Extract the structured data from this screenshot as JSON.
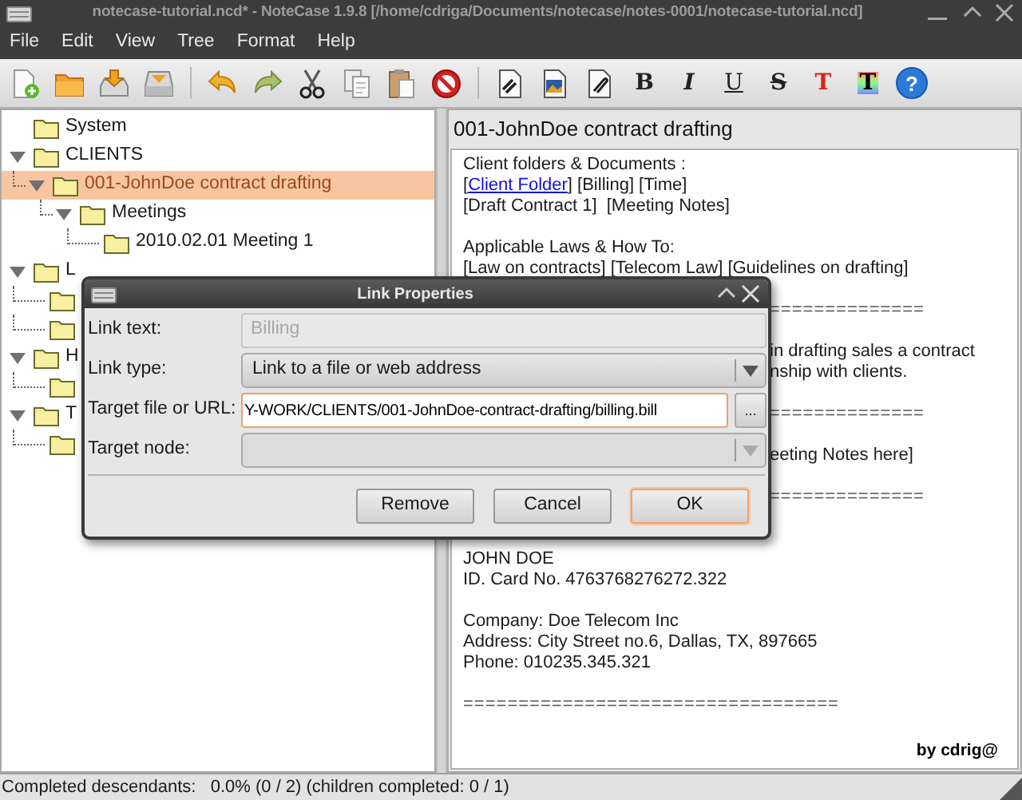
{
  "window": {
    "title": "notecase-tutorial.ncd* - NoteCase 1.9.8 [/home/cdriga/Documents/notecase/notes-0001/notecase-tutorial.ncd]"
  },
  "menu": [
    {
      "label": "File"
    },
    {
      "label": "Edit"
    },
    {
      "label": "View"
    },
    {
      "label": "Tree"
    },
    {
      "label": "Format"
    },
    {
      "label": "Help"
    }
  ],
  "toolbar": {
    "format_buttons": [
      {
        "kind": "bold",
        "label": "B"
      },
      {
        "kind": "italic",
        "label": "I"
      },
      {
        "kind": "underline",
        "label": "U"
      },
      {
        "kind": "strike",
        "label": "S"
      },
      {
        "kind": "text_color",
        "label": "T"
      },
      {
        "kind": "background_color",
        "label": "T"
      }
    ],
    "help_button": {
      "label": "?"
    }
  },
  "tree": [
    {
      "label": "System",
      "expanded": false,
      "selected": false
    },
    {
      "label": "CLIENTS",
      "expanded": true,
      "selected": false,
      "children": [
        {
          "label": "001-JohnDoe contract drafting",
          "expanded": true,
          "selected": true,
          "children": [
            {
              "label": "Meetings",
              "expanded": true,
              "selected": false,
              "children": [
                {
                  "label": "2010.02.01 Meeting 1",
                  "expanded": false,
                  "selected": false
                }
              ]
            }
          ]
        }
      ]
    },
    {
      "label": "L",
      "expanded": true,
      "selected": false,
      "children": [
        {
          "expanded": false,
          "selected": false
        },
        {
          "expanded": false,
          "selected": false
        }
      ]
    },
    {
      "label": "H",
      "expanded": true,
      "selected": false,
      "children": [
        {
          "expanded": false,
          "selected": false
        }
      ]
    },
    {
      "label": "T",
      "expanded": true,
      "selected": false,
      "children": [
        {
          "expanded": false,
          "selected": false
        }
      ]
    }
  ],
  "note": {
    "title": "001-JohnDoe contract drafting",
    "lines": [
      {
        "kind": "text",
        "segments": [
          {
            "text": "Client folders & Documents :",
            "link": false
          }
        ]
      },
      {
        "kind": "text",
        "segments": [
          {
            "text": "[",
            "link": false
          },
          {
            "text": "Client Folder",
            "link": true
          },
          {
            "text": "] [Billing] [Time]",
            "link": false
          }
        ]
      },
      {
        "kind": "text",
        "segments": [
          {
            "text": "[Draft Contract 1]  [Meeting Notes]",
            "link": false
          }
        ]
      },
      {
        "kind": "blank"
      },
      {
        "kind": "text",
        "segments": [
          {
            "text": "Applicable Laws & How To:",
            "link": false
          }
        ]
      },
      {
        "kind": "text",
        "segments": [
          {
            "text": "[Law on contracts] [Telecom Law] [Guidelines on drafting]",
            "link": false
          }
        ]
      },
      {
        "kind": "blank"
      },
      {
        "kind": "cut_rule",
        "text": "=============="
      },
      {
        "kind": "blank"
      },
      {
        "kind": "cut_text",
        "text": "in drafting sales a contract"
      },
      {
        "kind": "cut_text",
        "text": "nship with clients."
      },
      {
        "kind": "blank"
      },
      {
        "kind": "cut_rule",
        "text": "=============="
      },
      {
        "kind": "blank"
      },
      {
        "kind": "cut_text",
        "text": "eeting Notes here]"
      },
      {
        "kind": "blank"
      },
      {
        "kind": "cut_rule",
        "text": "=============="
      },
      {
        "kind": "blank"
      },
      {
        "kind": "blank"
      },
      {
        "kind": "text",
        "segments": [
          {
            "text": "JOHN DOE",
            "link": false
          }
        ]
      },
      {
        "kind": "text",
        "segments": [
          {
            "text": "ID. Card No. 4763768276272.322",
            "link": false
          }
        ]
      },
      {
        "kind": "blank"
      },
      {
        "kind": "text",
        "segments": [
          {
            "text": "Company: Doe Telecom Inc",
            "link": false
          }
        ]
      },
      {
        "kind": "text",
        "segments": [
          {
            "text": "Address: City Street no.6, Dallas, TX, 897665",
            "link": false
          }
        ]
      },
      {
        "kind": "text",
        "segments": [
          {
            "text": "Phone: 010235.345.321",
            "link": false
          }
        ]
      },
      {
        "kind": "blank"
      },
      {
        "kind": "rule",
        "text": "=================================="
      }
    ],
    "signature": "by cdrig@"
  },
  "dialog": {
    "title": "Link Properties",
    "fields": [
      {
        "kind": "text",
        "label": "Link text:",
        "value": "Billing",
        "disabled": true
      },
      {
        "kind": "combo",
        "label": "Link type:",
        "value": "Link to a file or web address",
        "disabled": false
      },
      {
        "kind": "file",
        "label": "Target file or URL:",
        "value": "Y-WORK/CLIENTS/001-JohnDoe-contract-drafting/billing.bill",
        "disabled": false,
        "browse_label": "..."
      },
      {
        "kind": "combo",
        "label": "Target node:",
        "disabled": true
      }
    ],
    "buttons": [
      {
        "label": "Remove",
        "default": false
      },
      {
        "label": "Cancel",
        "default": false
      },
      {
        "label": "OK",
        "default": true
      }
    ]
  },
  "status_bar": "Completed descendants:   0.0% (0 / 2) (children completed: 0 / 1)"
}
